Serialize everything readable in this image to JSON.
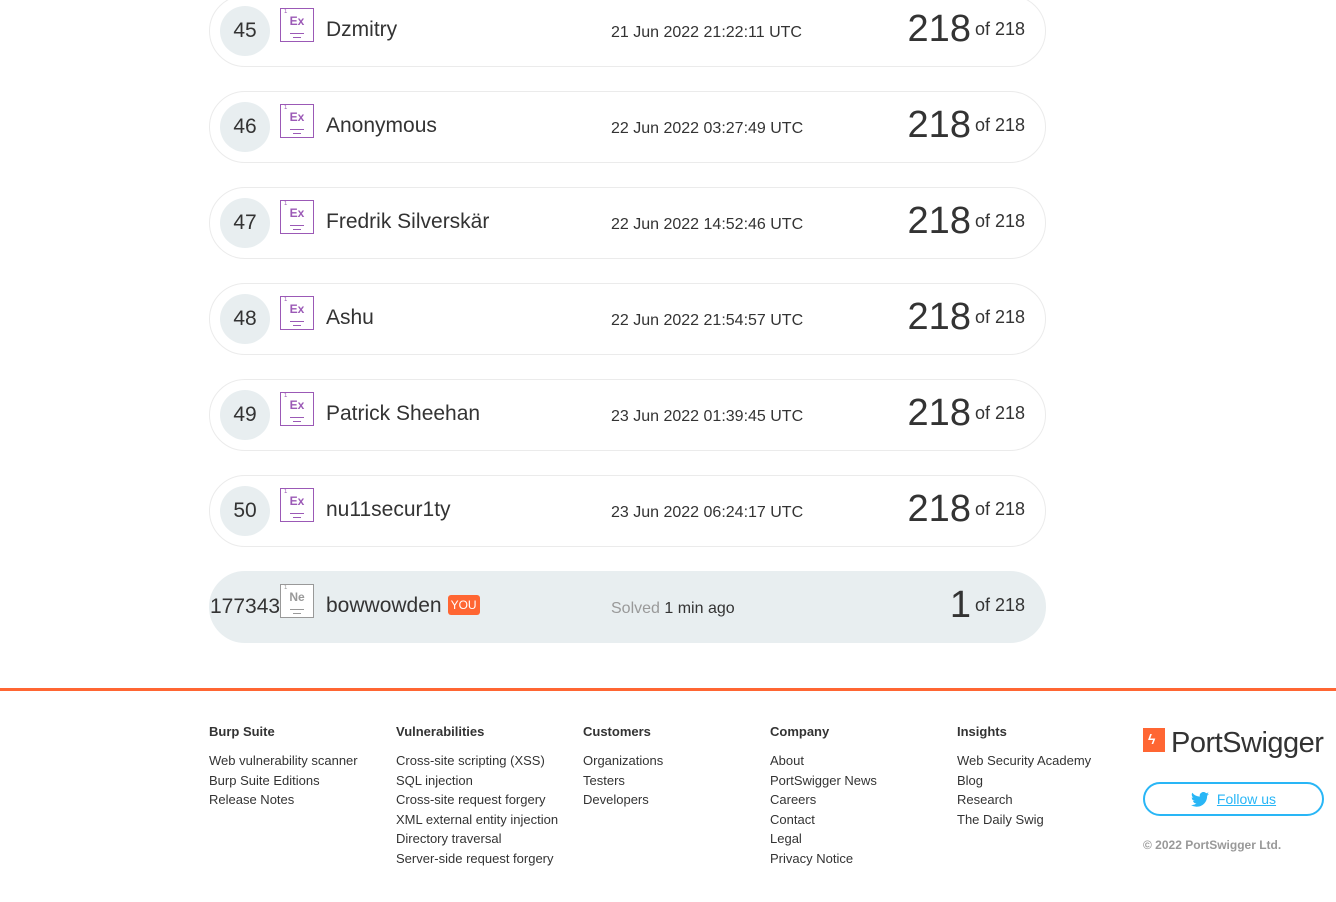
{
  "leaderboard": {
    "of_label": "of 218",
    "you_label": "YOU",
    "solved_label": "Solved",
    "rows": [
      {
        "rank": "45",
        "badge": "Ex",
        "name": "Dzmitry",
        "date": "21 Jun 2022 21:22:11 UTC",
        "score": "218"
      },
      {
        "rank": "46",
        "badge": "Ex",
        "name": "Anonymous",
        "date": "22 Jun 2022 03:27:49 UTC",
        "score": "218"
      },
      {
        "rank": "47",
        "badge": "Ex",
        "name": "Fredrik Silverskär",
        "date": "22 Jun 2022 14:52:46 UTC",
        "score": "218"
      },
      {
        "rank": "48",
        "badge": "Ex",
        "name": "Ashu",
        "date": "22 Jun 2022 21:54:57 UTC",
        "score": "218"
      },
      {
        "rank": "49",
        "badge": "Ex",
        "name": "Patrick Sheehan",
        "date": "23 Jun 2022 01:39:45 UTC",
        "score": "218"
      },
      {
        "rank": "50",
        "badge": "Ex",
        "name": "nu11secur1ty",
        "date": "23 Jun 2022 06:24:17 UTC",
        "score": "218"
      }
    ],
    "current_user": {
      "rank": "177343",
      "badge": "Ne",
      "name": "bowwowden",
      "solved_time": "1 min ago",
      "score": "1"
    }
  },
  "footer": {
    "columns": [
      {
        "heading": "Burp Suite",
        "links": [
          "Web vulnerability scanner",
          "Burp Suite Editions",
          "Release Notes"
        ]
      },
      {
        "heading": "Vulnerabilities",
        "links": [
          "Cross-site scripting (XSS)",
          "SQL injection",
          "Cross-site request forgery",
          "XML external entity injection",
          "Directory traversal",
          "Server-side request forgery"
        ]
      },
      {
        "heading": "Customers",
        "links": [
          "Organizations",
          "Testers",
          "Developers"
        ]
      },
      {
        "heading": "Company",
        "links": [
          "About",
          "PortSwigger News",
          "Careers",
          "Contact",
          "Legal",
          "Privacy Notice"
        ]
      },
      {
        "heading": "Insights",
        "links": [
          "Web Security Academy",
          "Blog",
          "Research",
          "The Daily Swig"
        ]
      }
    ],
    "logo_text": "PortSwigger",
    "follow_label": "Follow us",
    "copyright": "© 2022 PortSwigger Ltd.",
    "accent_color": "#ff6633",
    "twitter_color": "#29b6f6",
    "badge_color": "#9b59b6"
  }
}
